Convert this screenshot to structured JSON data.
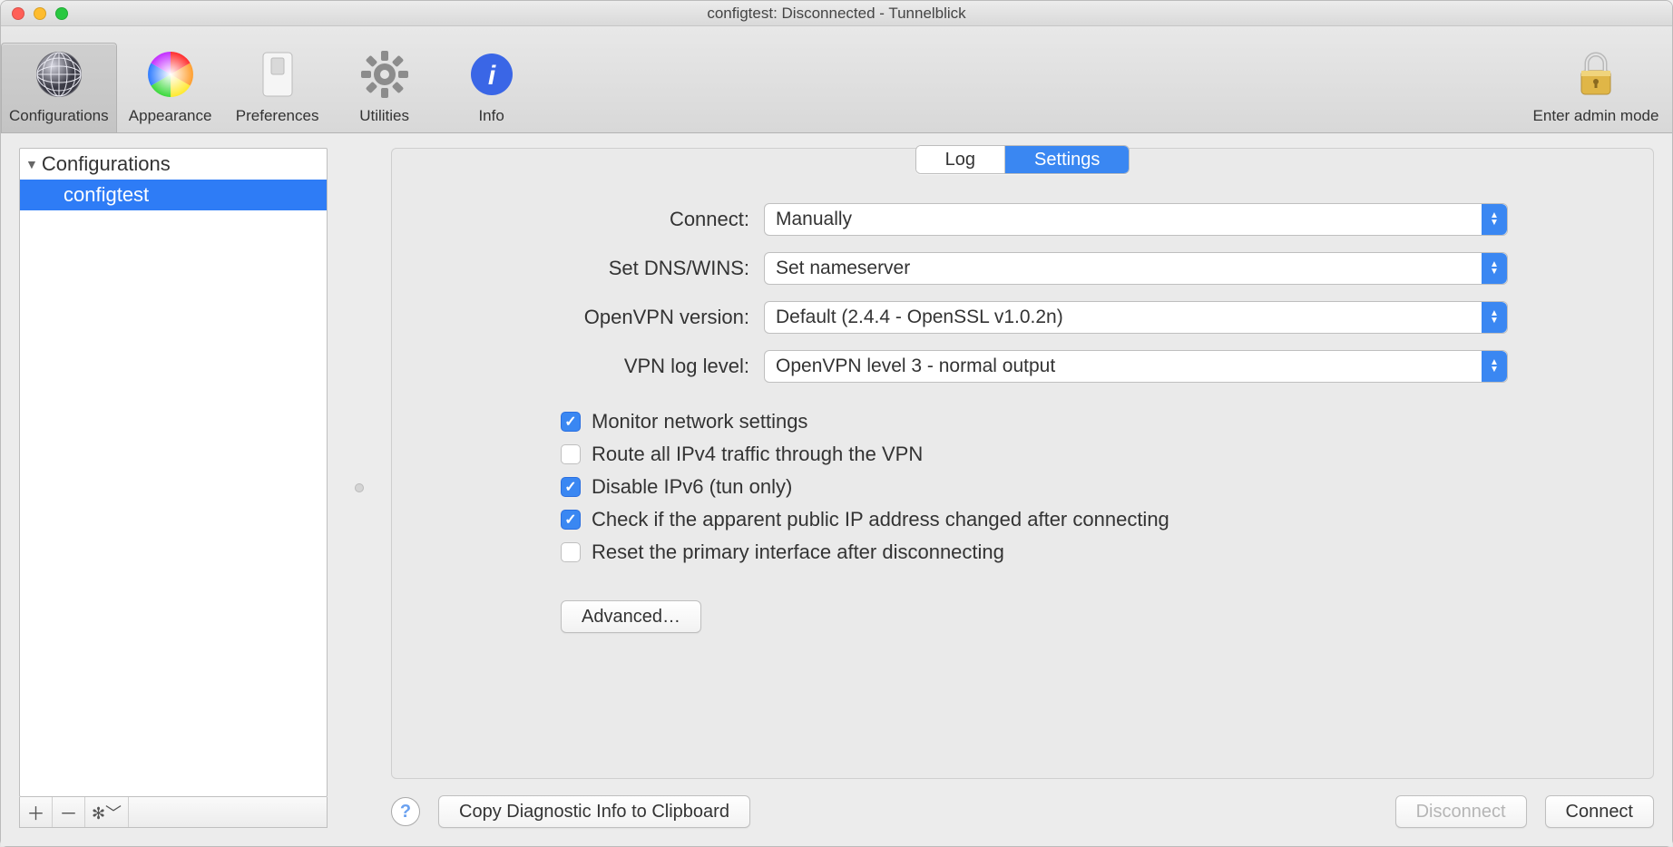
{
  "window": {
    "title": "configtest: Disconnected - Tunnelblick"
  },
  "toolbar": {
    "configurations": "Configurations",
    "appearance": "Appearance",
    "preferences": "Preferences",
    "utilities": "Utilities",
    "info": "Info",
    "admin": "Enter admin mode"
  },
  "sidebar": {
    "header": "Configurations",
    "items": [
      {
        "label": "configtest",
        "selected": true
      }
    ]
  },
  "tabs": {
    "log": "Log",
    "settings": "Settings"
  },
  "settings": {
    "connect_label": "Connect:",
    "connect_value": "Manually",
    "dns_label": "Set DNS/WINS:",
    "dns_value": "Set nameserver",
    "openvpn_label": "OpenVPN version:",
    "openvpn_value": "Default (2.4.4 - OpenSSL v1.0.2n)",
    "loglevel_label": "VPN log level:",
    "loglevel_value": "OpenVPN level 3 - normal output",
    "checks": {
      "monitor": {
        "label": "Monitor network settings",
        "checked": true
      },
      "route4": {
        "label": "Route all IPv4 traffic through the VPN",
        "checked": false
      },
      "dis6": {
        "label": "Disable IPv6 (tun only)",
        "checked": true
      },
      "pubip": {
        "label": "Check if the apparent public IP address changed after connecting",
        "checked": true
      },
      "resetif": {
        "label": "Reset the primary interface after disconnecting",
        "checked": false
      }
    },
    "advanced": "Advanced…"
  },
  "bottom": {
    "copy_diag": "Copy Diagnostic Info to Clipboard",
    "disconnect": "Disconnect",
    "connect": "Connect"
  }
}
